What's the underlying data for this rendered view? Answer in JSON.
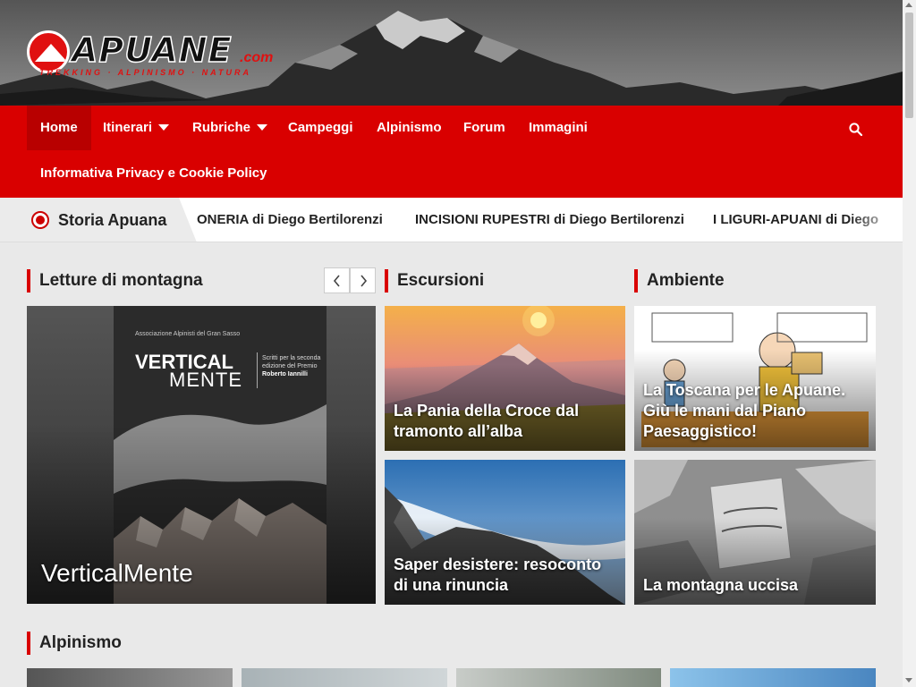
{
  "site": {
    "logo_text": "APUANE",
    "logo_domain": ".com",
    "logo_tagline": "TREKKING · ALPINISMO · NATURA"
  },
  "nav": {
    "items": [
      {
        "label": "Home",
        "active": true
      },
      {
        "label": "Itinerari",
        "dropdown": true
      },
      {
        "label": "Rubriche",
        "dropdown": true
      },
      {
        "label": "Campeggi"
      },
      {
        "label": "Alpinismo"
      },
      {
        "label": "Forum"
      },
      {
        "label": "Immagini"
      }
    ],
    "second_row": "Informativa Privacy e Cookie Policy",
    "search_icon": "search-icon"
  },
  "ticker": {
    "title": "Storia Apuana",
    "items": [
      "SONERIA di Diego Bertilorenzi",
      "INCISIONI RUPESTRI di Diego Bertilorenzi",
      "I LIGURI-APUANI di Diego"
    ]
  },
  "sections": {
    "letture": {
      "title": "Letture di montagna",
      "prev_icon": "chevron-left-icon",
      "next_icon": "chevron-right-icon",
      "card": {
        "title": "VerticalMente",
        "book_org": "Associazione Alpinisti del Gran Sasso",
        "book_title_1": "VERTICAL",
        "book_title_2": "MENTE",
        "book_side_1": "Scritti per la seconda edizione del Premio",
        "book_side_2": "Roberto Iannilli"
      }
    },
    "escursioni": {
      "title": "Escursioni",
      "cards": [
        {
          "title": "La Pania della Croce dal tramonto all’alba"
        },
        {
          "title": "Saper desistere: resoconto di una rinuncia"
        }
      ]
    },
    "ambiente": {
      "title": "Ambiente",
      "cards": [
        {
          "title": "La Toscana per le Apuane. Giù le mani dal Piano Paesaggistico!"
        },
        {
          "title": "La montagna uccisa"
        }
      ]
    },
    "alpinismo": {
      "title": "Alpinismo"
    }
  },
  "colors": {
    "brand_red": "#d90000",
    "nav_active": "#b80000"
  }
}
